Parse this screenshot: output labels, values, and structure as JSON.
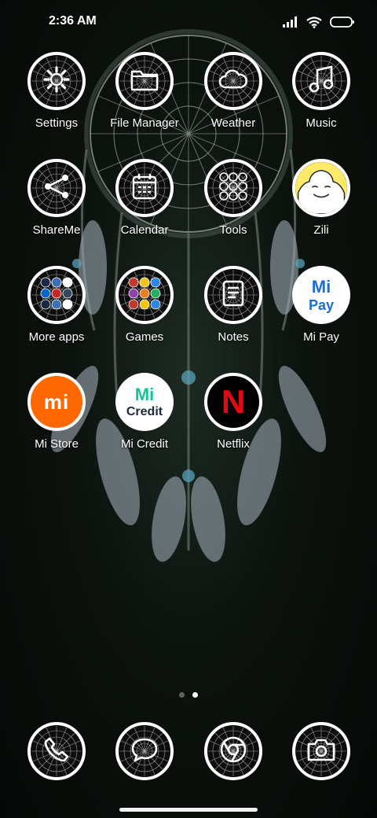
{
  "status_bar": {
    "time": "2:36 AM",
    "icons": [
      "signal-icon",
      "wifi-icon",
      "battery-icon"
    ]
  },
  "apps": [
    {
      "label": "Settings",
      "icon": "gear-icon"
    },
    {
      "label": "File Manager",
      "icon": "folder-icon"
    },
    {
      "label": "Weather",
      "icon": "cloud-icon"
    },
    {
      "label": "Music",
      "icon": "music-note-icon"
    },
    {
      "label": "ShareMe",
      "icon": "share-icon"
    },
    {
      "label": "Calendar",
      "icon": "calendar-icon"
    },
    {
      "label": "Tools",
      "icon": "tools-grid-icon"
    },
    {
      "label": "Zili",
      "icon": "zili-face-icon"
    },
    {
      "label": "More apps",
      "icon": "folder-more-apps-icon"
    },
    {
      "label": "Games",
      "icon": "folder-games-icon"
    },
    {
      "label": "Notes",
      "icon": "notes-icon"
    },
    {
      "label": "Mi Pay",
      "icon": "mi-pay-icon",
      "logo_text": [
        "Mi",
        "Pay"
      ]
    },
    {
      "label": "Mi Store",
      "icon": "mi-store-icon",
      "logo_text": "mi"
    },
    {
      "label": "Mi Credit",
      "icon": "mi-credit-icon",
      "logo_text": [
        "Mi",
        "Credit"
      ]
    },
    {
      "label": "Netflix",
      "icon": "netflix-icon",
      "logo_text": "N"
    }
  ],
  "dock": [
    {
      "icon": "phone-icon"
    },
    {
      "icon": "messages-icon"
    },
    {
      "icon": "chrome-icon"
    },
    {
      "icon": "camera-icon"
    }
  ],
  "page_indicator": {
    "pages": 2,
    "current": 2
  },
  "colors": {
    "mi_orange": "#ff6900",
    "mi_pay_blue": "#1b6fd0",
    "mi_credit_green": "#15c39a",
    "netflix_red": "#e50914",
    "zili_yellow": "#ffe96b"
  }
}
